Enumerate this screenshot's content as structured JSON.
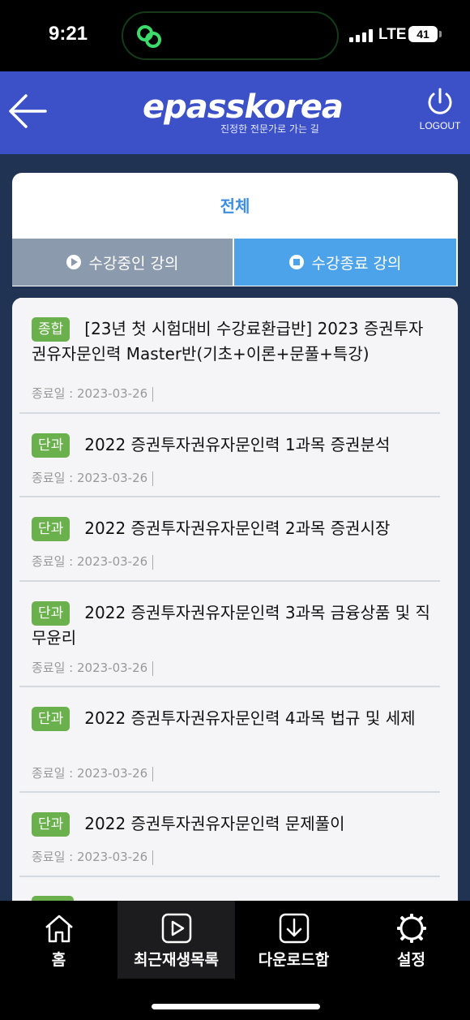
{
  "status_bar": {
    "time": "9:21",
    "network": "LTE",
    "battery": "41"
  },
  "header": {
    "logo_text": "epasskorea",
    "logo_tagline": "진정한 전문가로 가는 길",
    "logout_label": "LOGOUT",
    "back_icon": "arrow-left-icon",
    "logout_icon": "power-icon"
  },
  "filter": {
    "title": "전체",
    "tabs": [
      {
        "label": "수강중인 강의",
        "icon": "play-circle-icon"
      },
      {
        "label": "수강종료 강의",
        "icon": "stop-circle-icon"
      }
    ]
  },
  "courses": [
    {
      "badge": "종합",
      "title": "[23년 첫 시험대비 수강료환급반] 2023 증권투자권유자문인력 Master반(기초+이론+문풀+특강)",
      "date": "종료일 : 2023-03-26"
    },
    {
      "badge": "단과",
      "title": "2022 증권투자권유자문인력 1과목 증권분석",
      "date": "종료일 : 2023-03-26"
    },
    {
      "badge": "단과",
      "title": "2022 증권투자권유자문인력 2과목 증권시장",
      "date": "종료일 : 2023-03-26"
    },
    {
      "badge": "단과",
      "title": "2022 증권투자권유자문인력 3과목 금융상품 및 직무윤리",
      "date": "종료일 : 2023-03-26"
    },
    {
      "badge": "단과",
      "title": "2022 증권투자권유자문인력 4과목 법규 및 세제",
      "date": "종료일 : 2023-03-26"
    },
    {
      "badge": "단과",
      "title": "2022 증권투자권유자문인력 문제풀이",
      "date": "종료일 : 2023-03-26"
    }
  ],
  "bottom_nav": [
    {
      "label": "홈",
      "icon": "home-icon"
    },
    {
      "label": "최근재생목록",
      "icon": "play-square-icon"
    },
    {
      "label": "다운로드함",
      "icon": "download-icon"
    },
    {
      "label": "설정",
      "icon": "gear-icon"
    }
  ],
  "colors": {
    "header_bg": "#3c50c8",
    "main_bg": "#213352",
    "tab_active": "#8c9aae",
    "tab_inactive": "#4ca3ea",
    "badge_green": "#6ab04c",
    "title_blue": "#3d8ee0"
  }
}
